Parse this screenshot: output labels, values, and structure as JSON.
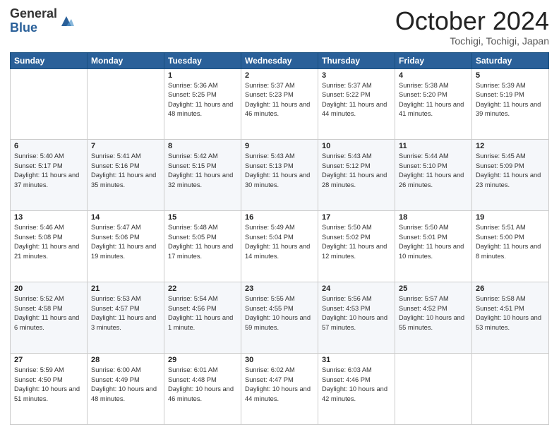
{
  "header": {
    "logo_general": "General",
    "logo_blue": "Blue",
    "month_title": "October 2024",
    "location": "Tochigi, Tochigi, Japan"
  },
  "columns": [
    "Sunday",
    "Monday",
    "Tuesday",
    "Wednesday",
    "Thursday",
    "Friday",
    "Saturday"
  ],
  "weeks": [
    [
      {
        "num": "",
        "info": ""
      },
      {
        "num": "",
        "info": ""
      },
      {
        "num": "1",
        "info": "Sunrise: 5:36 AM\nSunset: 5:25 PM\nDaylight: 11 hours and 48 minutes."
      },
      {
        "num": "2",
        "info": "Sunrise: 5:37 AM\nSunset: 5:23 PM\nDaylight: 11 hours and 46 minutes."
      },
      {
        "num": "3",
        "info": "Sunrise: 5:37 AM\nSunset: 5:22 PM\nDaylight: 11 hours and 44 minutes."
      },
      {
        "num": "4",
        "info": "Sunrise: 5:38 AM\nSunset: 5:20 PM\nDaylight: 11 hours and 41 minutes."
      },
      {
        "num": "5",
        "info": "Sunrise: 5:39 AM\nSunset: 5:19 PM\nDaylight: 11 hours and 39 minutes."
      }
    ],
    [
      {
        "num": "6",
        "info": "Sunrise: 5:40 AM\nSunset: 5:17 PM\nDaylight: 11 hours and 37 minutes."
      },
      {
        "num": "7",
        "info": "Sunrise: 5:41 AM\nSunset: 5:16 PM\nDaylight: 11 hours and 35 minutes."
      },
      {
        "num": "8",
        "info": "Sunrise: 5:42 AM\nSunset: 5:15 PM\nDaylight: 11 hours and 32 minutes."
      },
      {
        "num": "9",
        "info": "Sunrise: 5:43 AM\nSunset: 5:13 PM\nDaylight: 11 hours and 30 minutes."
      },
      {
        "num": "10",
        "info": "Sunrise: 5:43 AM\nSunset: 5:12 PM\nDaylight: 11 hours and 28 minutes."
      },
      {
        "num": "11",
        "info": "Sunrise: 5:44 AM\nSunset: 5:10 PM\nDaylight: 11 hours and 26 minutes."
      },
      {
        "num": "12",
        "info": "Sunrise: 5:45 AM\nSunset: 5:09 PM\nDaylight: 11 hours and 23 minutes."
      }
    ],
    [
      {
        "num": "13",
        "info": "Sunrise: 5:46 AM\nSunset: 5:08 PM\nDaylight: 11 hours and 21 minutes."
      },
      {
        "num": "14",
        "info": "Sunrise: 5:47 AM\nSunset: 5:06 PM\nDaylight: 11 hours and 19 minutes."
      },
      {
        "num": "15",
        "info": "Sunrise: 5:48 AM\nSunset: 5:05 PM\nDaylight: 11 hours and 17 minutes."
      },
      {
        "num": "16",
        "info": "Sunrise: 5:49 AM\nSunset: 5:04 PM\nDaylight: 11 hours and 14 minutes."
      },
      {
        "num": "17",
        "info": "Sunrise: 5:50 AM\nSunset: 5:02 PM\nDaylight: 11 hours and 12 minutes."
      },
      {
        "num": "18",
        "info": "Sunrise: 5:50 AM\nSunset: 5:01 PM\nDaylight: 11 hours and 10 minutes."
      },
      {
        "num": "19",
        "info": "Sunrise: 5:51 AM\nSunset: 5:00 PM\nDaylight: 11 hours and 8 minutes."
      }
    ],
    [
      {
        "num": "20",
        "info": "Sunrise: 5:52 AM\nSunset: 4:58 PM\nDaylight: 11 hours and 6 minutes."
      },
      {
        "num": "21",
        "info": "Sunrise: 5:53 AM\nSunset: 4:57 PM\nDaylight: 11 hours and 3 minutes."
      },
      {
        "num": "22",
        "info": "Sunrise: 5:54 AM\nSunset: 4:56 PM\nDaylight: 11 hours and 1 minute."
      },
      {
        "num": "23",
        "info": "Sunrise: 5:55 AM\nSunset: 4:55 PM\nDaylight: 10 hours and 59 minutes."
      },
      {
        "num": "24",
        "info": "Sunrise: 5:56 AM\nSunset: 4:53 PM\nDaylight: 10 hours and 57 minutes."
      },
      {
        "num": "25",
        "info": "Sunrise: 5:57 AM\nSunset: 4:52 PM\nDaylight: 10 hours and 55 minutes."
      },
      {
        "num": "26",
        "info": "Sunrise: 5:58 AM\nSunset: 4:51 PM\nDaylight: 10 hours and 53 minutes."
      }
    ],
    [
      {
        "num": "27",
        "info": "Sunrise: 5:59 AM\nSunset: 4:50 PM\nDaylight: 10 hours and 51 minutes."
      },
      {
        "num": "28",
        "info": "Sunrise: 6:00 AM\nSunset: 4:49 PM\nDaylight: 10 hours and 48 minutes."
      },
      {
        "num": "29",
        "info": "Sunrise: 6:01 AM\nSunset: 4:48 PM\nDaylight: 10 hours and 46 minutes."
      },
      {
        "num": "30",
        "info": "Sunrise: 6:02 AM\nSunset: 4:47 PM\nDaylight: 10 hours and 44 minutes."
      },
      {
        "num": "31",
        "info": "Sunrise: 6:03 AM\nSunset: 4:46 PM\nDaylight: 10 hours and 42 minutes."
      },
      {
        "num": "",
        "info": ""
      },
      {
        "num": "",
        "info": ""
      }
    ]
  ]
}
